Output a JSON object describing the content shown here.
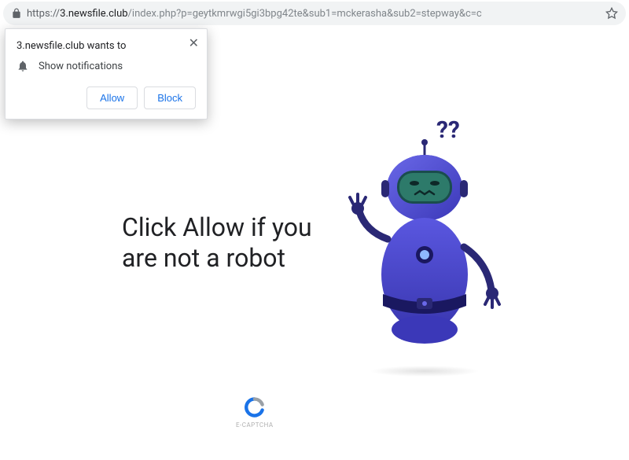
{
  "address": {
    "scheme": "https://",
    "host": "3.newsfile.club",
    "path": "/index.php?p=geytkmrwgi5gi3bpg42te&sub1=mckerasha&sub2=stepway&c=c"
  },
  "notification": {
    "title": "3.newsfile.club wants to",
    "message": "Show notifications",
    "allow": "Allow",
    "block": "Block"
  },
  "page": {
    "headline": "Click Allow if you are not a robot",
    "captcha_label": "E-CAPTCHA",
    "question_marks": "??"
  },
  "colors": {
    "robot_primary": "#4e4bd6",
    "robot_dark": "#2a2875",
    "accent": "#1a73e8"
  }
}
